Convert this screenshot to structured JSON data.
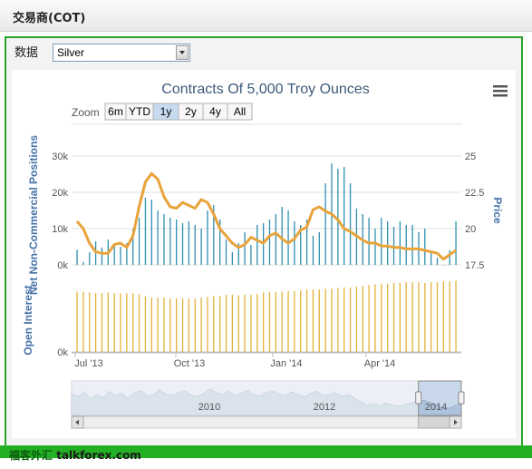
{
  "header": {
    "title": "交易商(COT)"
  },
  "selector": {
    "label": "数据",
    "value": "Silver"
  },
  "watermark": {
    "cn": "福客外汇",
    "site": "talkforex.com"
  },
  "colors": {
    "frame_green": "#2aa52a",
    "bar_blue": "#2f8fb0",
    "price_orange": "#e8a33a",
    "oi_gold": "#e2b23a",
    "axis_title_blue": "#4572a7"
  },
  "chart_data": {
    "type": "bar",
    "title": "Contracts Of 5,000 Troy Ounces",
    "menu_icon": "hamburger-menu-icon",
    "zoom": {
      "label": "Zoom",
      "buttons": [
        "6m",
        "YTD",
        "1y",
        "2y",
        "4y",
        "All"
      ],
      "selected": "1y"
    },
    "x_ticks": [
      "Jul '13",
      "Oct '13",
      "Jan '14",
      "Apr '14"
    ],
    "x_range": [
      "2013-06-25",
      "2014-06-25"
    ],
    "left_axis_top": {
      "title": "Net Non-Commercial Positions",
      "ticks": [
        "30k",
        "20k",
        "10k",
        "0k"
      ],
      "ylim": [
        0,
        30000
      ]
    },
    "left_axis_bottom": {
      "title": "Open Interest",
      "ticks": [
        "0k"
      ]
    },
    "right_axis": {
      "title": "Price",
      "ticks": [
        "25",
        "22.5",
        "20",
        "17.5"
      ],
      "ylim": [
        17.5,
        25
      ]
    },
    "series": [
      {
        "name": "Net Non-Commercial Positions",
        "axis": "left",
        "values": [
          4200,
          800,
          3500,
          6500,
          4800,
          7000,
          5200,
          5000,
          6000,
          10000,
          13000,
          18500,
          18000,
          15000,
          14000,
          13000,
          12500,
          11500,
          12000,
          11000,
          10000,
          15000,
          16500,
          12500,
          7000,
          3500,
          6000,
          9000,
          5500,
          11000,
          11500,
          12500,
          14000,
          16000,
          15000,
          12000,
          11000,
          12500,
          8000,
          9000,
          22500,
          28000,
          26500,
          27000,
          22500,
          15500,
          14000,
          13000,
          10000,
          13000,
          12000,
          10500,
          12000,
          11000,
          11000,
          9000,
          10000,
          4000,
          2000,
          0,
          4000,
          12000
        ]
      },
      {
        "name": "Price",
        "axis": "right",
        "values": [
          20.5,
          20.0,
          19.0,
          18.4,
          18.3,
          18.3,
          18.9,
          19.0,
          18.7,
          19.5,
          21.5,
          23.2,
          23.8,
          23.4,
          22.2,
          21.5,
          21.4,
          21.8,
          21.6,
          21.4,
          22.0,
          21.8,
          21.0,
          20.0,
          19.5,
          19.0,
          18.7,
          18.9,
          19.4,
          19.2,
          19.0,
          19.5,
          19.7,
          19.3,
          19.0,
          19.3,
          19.9,
          20.1,
          21.3,
          21.5,
          21.2,
          21.0,
          20.6,
          20.0,
          19.8,
          19.5,
          19.2,
          19.0,
          19.0,
          18.8,
          18.8,
          18.7,
          18.7,
          18.6,
          18.6,
          18.6,
          18.5,
          18.4,
          18.3,
          17.9,
          18.2,
          18.5
        ]
      },
      {
        "name": "Open Interest",
        "axis": "left-bottom",
        "values": [
          0.82,
          0.82,
          0.81,
          0.8,
          0.8,
          0.81,
          0.8,
          0.8,
          0.8,
          0.8,
          0.79,
          0.76,
          0.74,
          0.74,
          0.74,
          0.73,
          0.73,
          0.73,
          0.73,
          0.73,
          0.74,
          0.75,
          0.76,
          0.76,
          0.78,
          0.78,
          0.77,
          0.78,
          0.78,
          0.79,
          0.81,
          0.82,
          0.82,
          0.82,
          0.83,
          0.83,
          0.84,
          0.85,
          0.85,
          0.85,
          0.86,
          0.86,
          0.87,
          0.88,
          0.88,
          0.89,
          0.9,
          0.91,
          0.92,
          0.93,
          0.93,
          0.94,
          0.94,
          0.95,
          0.95,
          0.95,
          0.94,
          0.95,
          0.95,
          0.96,
          0.96,
          0.97
        ]
      }
    ],
    "navigator": {
      "labels": [
        "2010",
        "2012",
        "2014"
      ],
      "values": [
        0.62,
        0.55,
        0.68,
        0.48,
        0.6,
        0.52,
        0.7,
        0.58,
        0.64,
        0.5,
        0.66,
        0.72,
        0.56,
        0.6,
        0.74,
        0.62,
        0.58,
        0.66,
        0.7,
        0.6,
        0.54,
        0.64,
        0.76,
        0.66,
        0.6,
        0.7,
        0.58,
        0.64,
        0.72,
        0.6,
        0.56,
        0.66,
        0.7,
        0.62,
        0.58,
        0.68,
        0.6,
        0.54,
        0.64,
        0.7,
        0.58,
        0.6,
        0.66,
        0.56,
        0.6,
        0.5,
        0.4,
        0.3,
        0.34,
        0.28,
        0.36,
        0.3,
        0.26,
        0.32,
        0.36,
        0.4,
        0.44,
        0.38,
        0.3,
        0.22,
        0.2,
        0.28,
        0.35
      ],
      "selection": [
        0.89,
        1.0
      ]
    }
  }
}
